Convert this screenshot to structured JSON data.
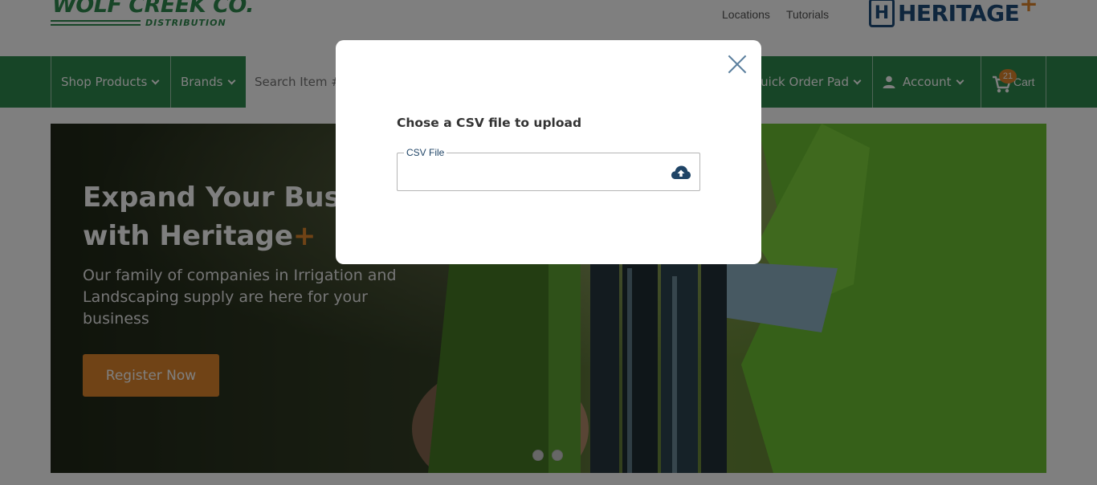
{
  "header": {
    "wcc_logo_title": "WOLF CREEK CO.",
    "wcc_logo_subtitle": "DISTRIBUTION",
    "links": [
      "Locations",
      "Tutorials"
    ],
    "heritage_logo_text": "HERITAGE",
    "heritage_logo_plus": "+",
    "heritage_logo_letter": "H"
  },
  "nav": {
    "shop_products": "Shop Products",
    "brands": "Brands",
    "search_placeholder": "Search Item #",
    "quick_order_pad": "uick Order Pad",
    "account": "Account",
    "cart_label": "Cart",
    "cart_count": "21"
  },
  "hero": {
    "title_line1": "Expand Your Busi",
    "title_line2": "with Heritage",
    "title_plus": "+",
    "subtitle": "Our family of companies in Irrigation and Landscaping supply are here for your business",
    "register_label": "Register Now"
  },
  "modal": {
    "heading": "Chose a CSV file to upload",
    "field_label": "CSV File"
  },
  "colors": {
    "brand_green": "#2f8a4e",
    "accent_orange": "#e0872c",
    "heritage_blue": "#1e4c7a"
  },
  "icons": [
    "close-icon",
    "upload-cloud-icon",
    "user-icon",
    "cart-icon",
    "chevron-down-icon"
  ]
}
